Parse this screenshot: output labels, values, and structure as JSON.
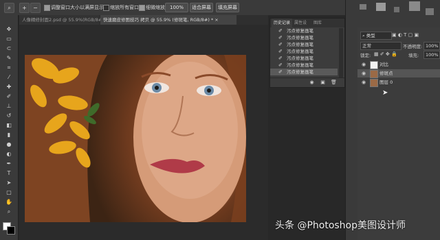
{
  "options_bar": {
    "check1_label": "调整窗口大小以满屏显示",
    "check2_label": "缩放所有窗口",
    "check3_label": "细微缩放",
    "zoom_value": "100%",
    "fit_screen_label": "适合屏幕",
    "fill_screen_label": "填充屏幕"
  },
  "tabs": [
    {
      "label": "人像精修封面2.psd @ 55.9%(RGB/8#)",
      "close": "×"
    },
    {
      "label": "快速磨皮修图技巧 拷贝 @ 55.9% (修斑笔, RGB/8#) *",
      "close": "×"
    }
  ],
  "history": {
    "tabs": [
      "历史记录",
      "属性设",
      "图库"
    ],
    "items": [
      "污点修复画笔",
      "污点修复画笔",
      "污点修复画笔",
      "污点修复画笔",
      "污点修复画笔",
      "污点修复画笔",
      "污点修复画笔"
    ],
    "selected_index": 6
  },
  "layers": {
    "filter_label": "类型",
    "blend_mode": "正常",
    "opacity_label": "不透明度:",
    "opacity_value": "100%",
    "lock_label": "锁定:",
    "fill_label": "填充:",
    "fill_value": "100%",
    "rows": [
      {
        "name": "对比",
        "thumb": "white"
      },
      {
        "name": "修斑点",
        "thumb": "photo"
      },
      {
        "name": "图层 0",
        "thumb": "photo"
      }
    ],
    "selected_index": 1
  },
  "watermark": "头条 @Photoshop美图设计师"
}
